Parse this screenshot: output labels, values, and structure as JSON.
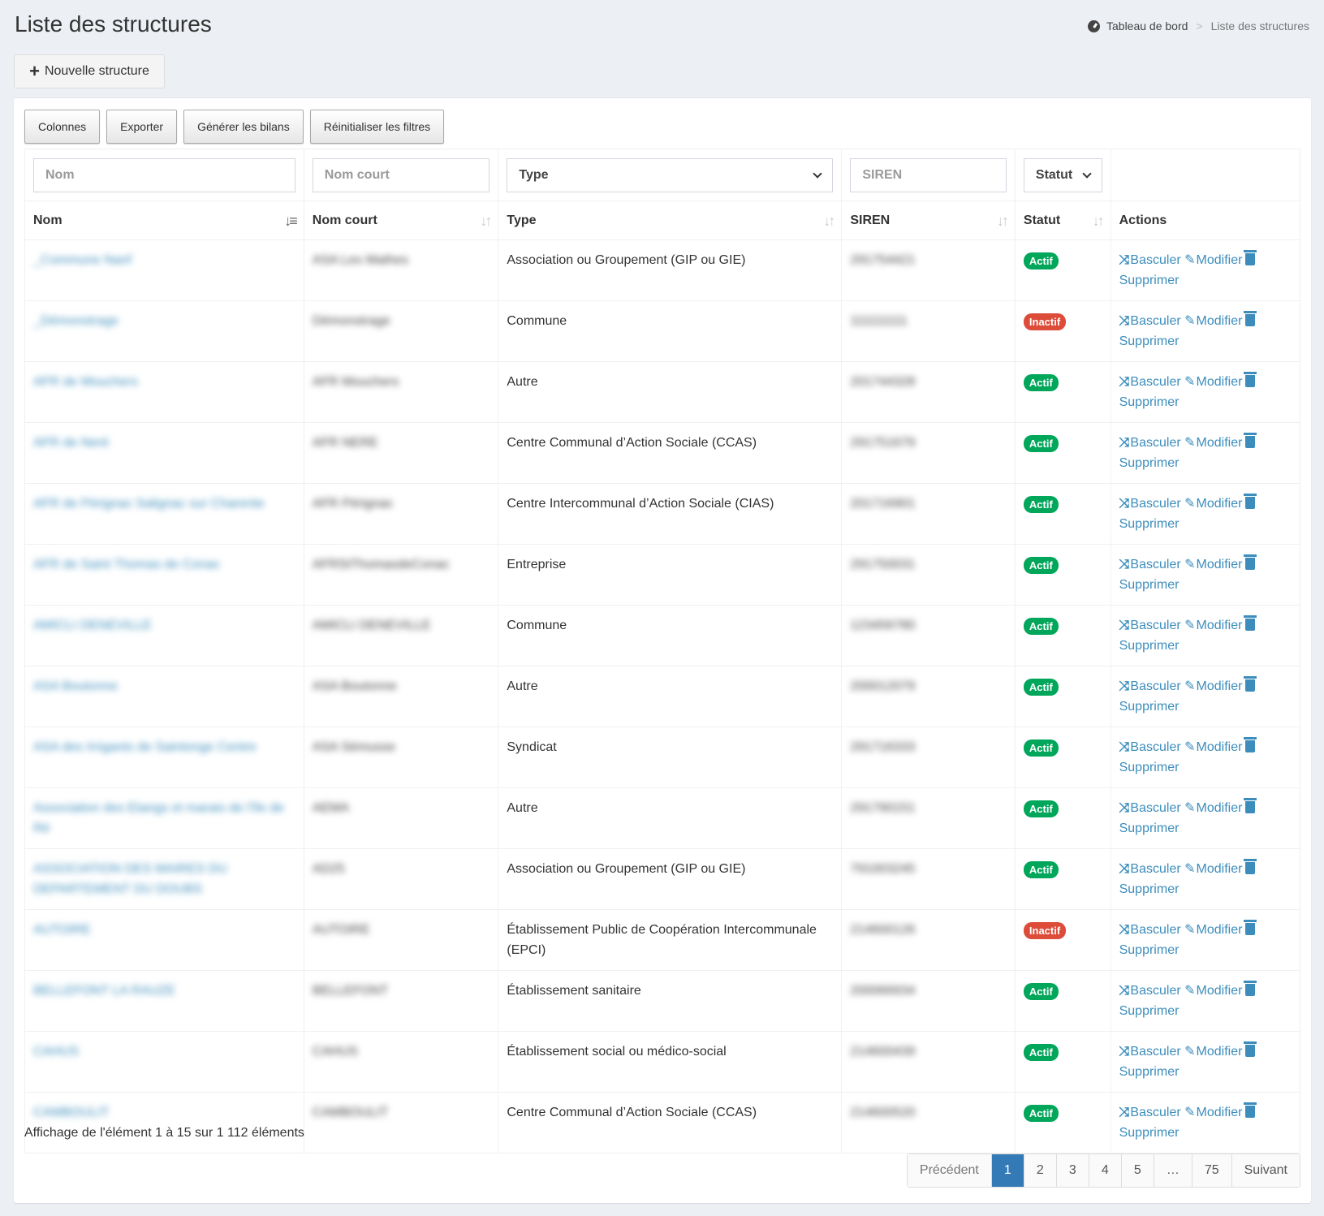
{
  "header": {
    "title": "Liste des structures",
    "breadcrumb": {
      "home": "Tableau de bord",
      "current": "Liste des structures"
    },
    "new_button": "Nouvelle structure"
  },
  "toolbar": [
    "Colonnes",
    "Exporter",
    "Générer les bilans",
    "Réinitialiser les filtres"
  ],
  "filters": {
    "nom_placeholder": "Nom",
    "nom_court_placeholder": "Nom court",
    "type_selected": "Type",
    "siren_placeholder": "SIREN",
    "statut_selected": "Statut"
  },
  "columns": [
    "Nom",
    "Nom court",
    "Type",
    "SIREN",
    "Statut",
    "Actions"
  ],
  "action_labels": {
    "toggle": "Basculer",
    "edit": "Modifier",
    "delete": "Supprimer"
  },
  "status_colors": {
    "actif": "#00a65a",
    "inactif": "#dd4b39",
    "link": "#3c8dbc"
  },
  "rows": [
    {
      "nom": "_Commune Nanf",
      "nom_court": "ASA Les Mathes",
      "type": "Association ou Groupement (GIP ou GIE)",
      "siren": "291754421",
      "statut": "Actif"
    },
    {
      "nom": "_Démonstrage",
      "nom_court": "Démonstrage",
      "type": "Commune",
      "siren": "111111111",
      "statut": "Inactif"
    },
    {
      "nom": "AFR de Mouchers",
      "nom_court": "AFR Mouchers",
      "type": "Autre",
      "siren": "201744328",
      "statut": "Actif"
    },
    {
      "nom": "AFR de Nerè",
      "nom_court": "AFR NERE",
      "type": "Centre Communal d’Action Sociale (CCAS)",
      "siren": "291751679",
      "statut": "Actif"
    },
    {
      "nom": "AFR de Pérignac Salignac sur Charente",
      "nom_court": "AFR Pérignac",
      "type": "Centre Intercommunal d’Action Sociale (CIAS)",
      "siren": "201716901",
      "statut": "Actif"
    },
    {
      "nom": "AFR de Saint Thomas de Conac",
      "nom_court": "AFRStThomasdeConac",
      "type": "Entreprise",
      "siren": "291750031",
      "statut": "Actif"
    },
    {
      "nom": "AMICLI DENEVILLE",
      "nom_court": "AMICLI DENEVILLE",
      "type": "Commune",
      "siren": "123456780",
      "statut": "Actif"
    },
    {
      "nom": "ASA Boutonne",
      "nom_court": "ASA Boutonne",
      "type": "Autre",
      "siren": "200012079",
      "statut": "Actif"
    },
    {
      "nom": "ASA des Irrigants de Saintonge Centre",
      "nom_court": "ASA Sémusse",
      "type": "Syndicat",
      "siren": "291716333",
      "statut": "Actif"
    },
    {
      "nom": "Association des Etangs et marais de l'île de Ré",
      "nom_court": "AEMA",
      "type": "Autre",
      "siren": "291790151",
      "statut": "Actif"
    },
    {
      "nom": "ASSOCIATION DES MAIRES DU DEPARTEMENT DU DOUBS",
      "nom_court": "AD25",
      "type": "Association ou Groupement (GIP ou GIE)",
      "siren": "791003245",
      "statut": "Actif"
    },
    {
      "nom": "AUTOIRE",
      "nom_court": "AUTOIRE",
      "type": "Établissement Public de Coopération Intercommunale (EPCI)",
      "siren": "214600126",
      "statut": "Inactif"
    },
    {
      "nom": "BELLEFONT LA RAUZE",
      "nom_court": "BELLEFONT",
      "type": "Établissement sanitaire",
      "siren": "200066934",
      "statut": "Actif"
    },
    {
      "nom": "CAHUS",
      "nom_court": "CAHUS",
      "type": "Établissement social ou médico-social",
      "siren": "214600439",
      "statut": "Actif"
    },
    {
      "nom": "CAMBOULIT",
      "nom_court": "CAMBOULIT",
      "type": "Centre Communal d’Action Sociale (CCAS)",
      "siren": "214600520",
      "statut": "Actif"
    }
  ],
  "footer": {
    "info": "Affichage de l'élément 1 à 15 sur 1 112 éléments",
    "pagination": [
      "Précédent",
      "1",
      "2",
      "3",
      "4",
      "5",
      "…",
      "75",
      "Suivant"
    ],
    "active_page": "1"
  }
}
